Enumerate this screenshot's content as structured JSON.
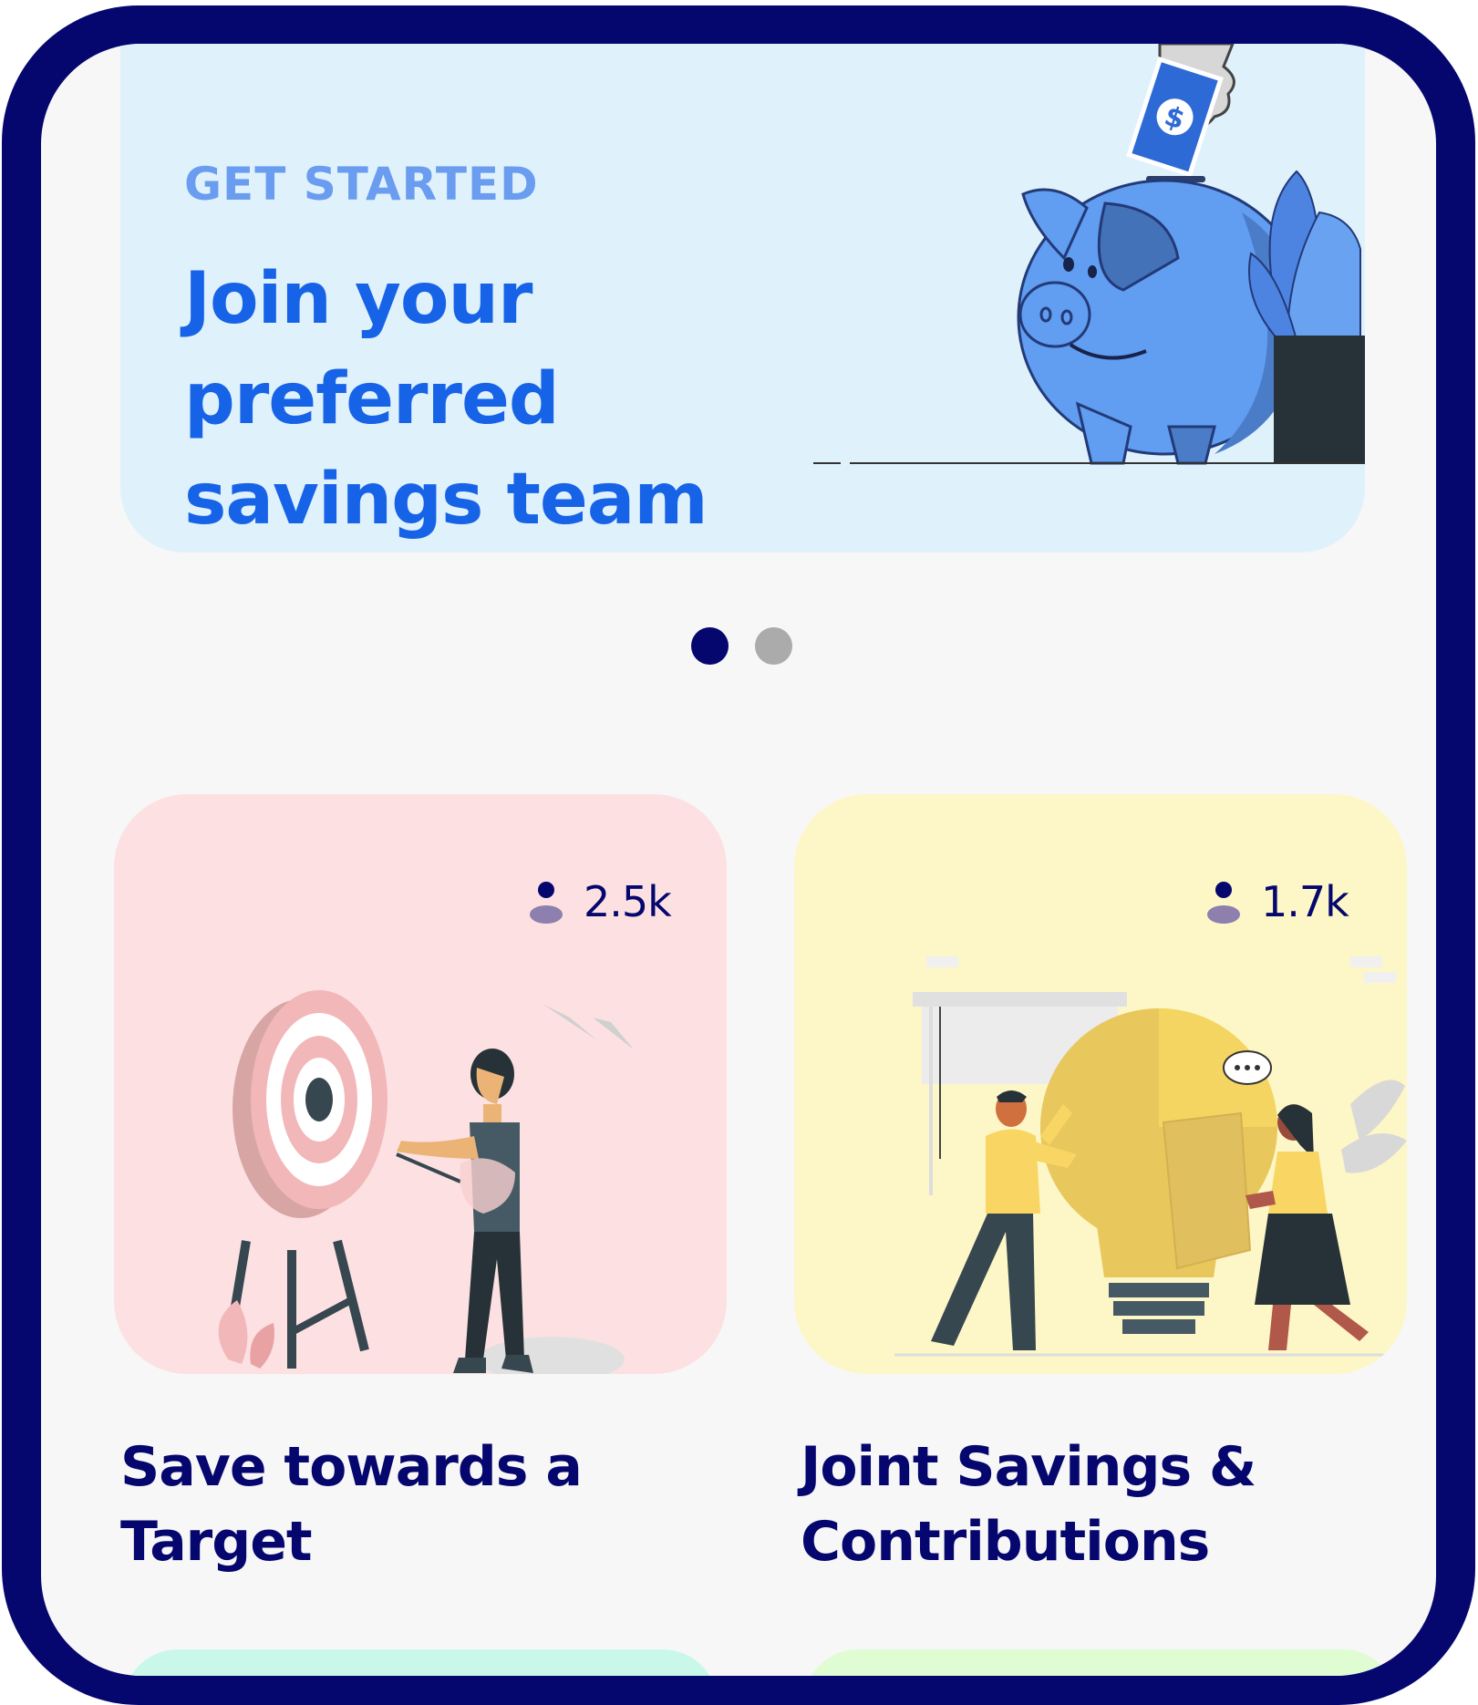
{
  "banner": {
    "eyebrow": "GET STARTED",
    "title": "Join your preferred savings team"
  },
  "carousel": {
    "total_pages": 2,
    "active_page": 1
  },
  "cards": [
    {
      "title": "Save towards a Target",
      "members": "2.5k",
      "color": "#fde1e2"
    },
    {
      "title": "Joint Savings & Contributions",
      "members": "1.7k",
      "color": "#fdf6c6"
    }
  ],
  "colors": {
    "frame": "#05066e",
    "accent_blue": "#1763e8",
    "navy_text": "#05066e",
    "banner_bg": "#dff2fc",
    "dot_inactive": "#ababab"
  }
}
